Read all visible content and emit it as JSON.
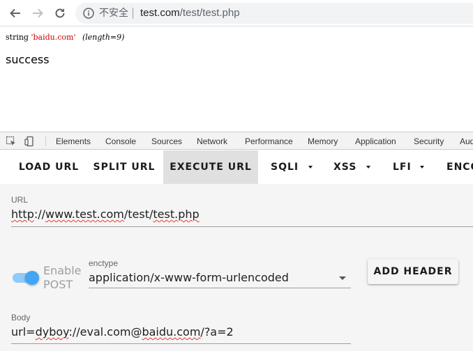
{
  "browser": {
    "security_label": "不安全",
    "url_host": "test.com",
    "url_path": "/test/test.php"
  },
  "page": {
    "dump_type": "string",
    "dump_value": "'baidu.com'",
    "dump_length": "(length=9)",
    "result": "success"
  },
  "devtools": {
    "tabs": [
      "Elements",
      "Console",
      "Sources",
      "Network",
      "Performance",
      "Memory",
      "Application",
      "Security",
      "Aud"
    ]
  },
  "hackbar": {
    "buttons": [
      "LOAD URL",
      "SPLIT URL",
      "EXECUTE URL",
      "SQLI",
      "XSS",
      "LFI",
      "ENCO"
    ],
    "active": "EXECUTE URL"
  },
  "form": {
    "url_label": "URL",
    "url_value_parts": [
      "http",
      "://",
      "www.test.com",
      "/test/",
      "test.php"
    ],
    "toggle_label_line1": "Enable",
    "toggle_label_line2": "POST",
    "toggle_on": true,
    "enctype_label": "enctype",
    "enctype_value": "application/x-www-form-urlencoded",
    "add_header_label": "ADD HEADER",
    "body_label": "Body",
    "body_value_parts": [
      "url=",
      "dyboy",
      "://eval.com@",
      "baidu.com",
      "/?a=2"
    ]
  },
  "colors": {
    "toggle_thumb": "#42a5f5",
    "toggle_track": "#90caf9",
    "active_tab_bg": "#e0e0e0",
    "form_bg": "#f5f5f5"
  }
}
